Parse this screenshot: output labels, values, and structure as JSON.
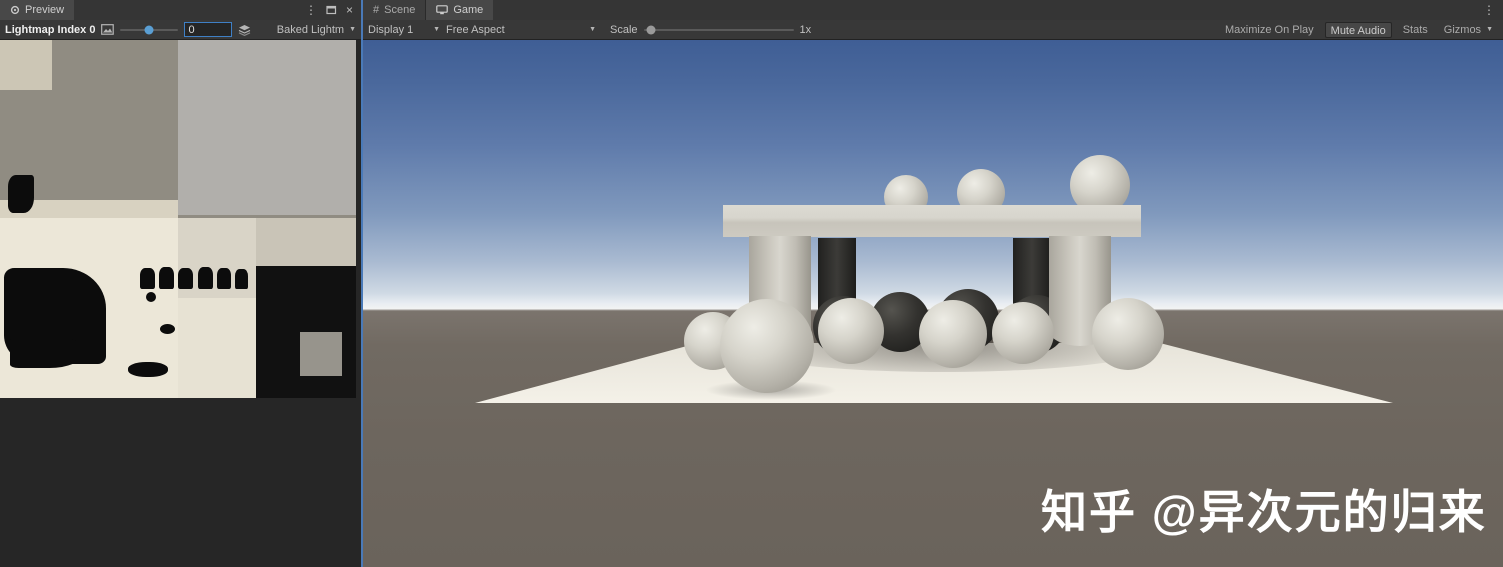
{
  "preview_panel": {
    "tab": "Preview",
    "toolbar": {
      "label": "Lightmap Index 0",
      "value": "0",
      "mode": "Baked Lightm"
    }
  },
  "game_panel": {
    "tabs": {
      "scene": "Scene",
      "game": "Game"
    },
    "toolbar": {
      "display": "Display 1",
      "aspect": "Free Aspect",
      "scale_label": "Scale",
      "scale_value": "1x",
      "maximize_on_play": "Maximize On Play",
      "mute_audio": "Mute Audio",
      "stats": "Stats",
      "gizmos": "Gizmos"
    },
    "watermark": "知乎 @异次元的归来"
  },
  "icons": {
    "menu": "⋮",
    "close": "×",
    "caret": "▼",
    "scene_glyph": "#"
  },
  "colors": {
    "accent_blue": "#4a7ab8",
    "sky_top": "#3f5e95",
    "sky_horizon": "#f2f3f3",
    "ground_brown": "#6e665e",
    "floor_white": "#f2efe6",
    "toolbar_bg": "#383838",
    "tab_active": "#484848",
    "lightmap_cream": "#ece7d8",
    "lightmap_black": "#111111"
  }
}
